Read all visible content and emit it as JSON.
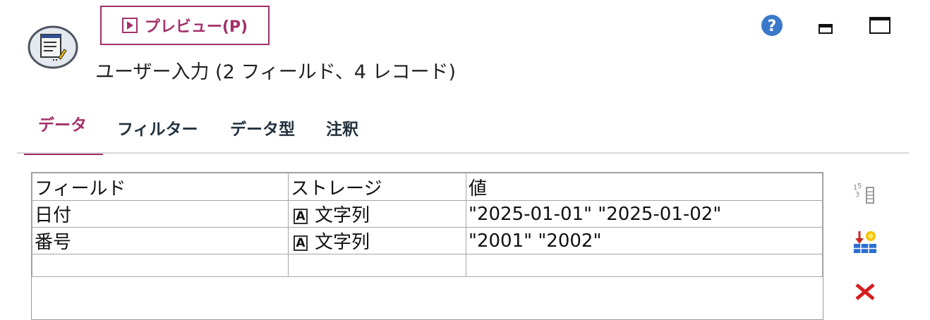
{
  "toolbar": {
    "preview_label": "プレビュー(P)"
  },
  "node": {
    "title": "ユーザー入力 (2 フィールド、4 レコード)"
  },
  "icons": {
    "node": "user-input-node-icon",
    "help": "help-icon",
    "minimize": "minimize-icon",
    "maximize": "maximize-icon",
    "side": [
      "numbered-list-icon",
      "generate-data-icon",
      "delete-icon"
    ]
  },
  "tabs": [
    {
      "label": "データ",
      "active": true
    },
    {
      "label": "フィルター",
      "active": false
    },
    {
      "label": "データ型",
      "active": false
    },
    {
      "label": "注釈",
      "active": false
    }
  ],
  "table": {
    "headers": [
      "フィールド",
      "ストレージ",
      "値"
    ],
    "rows": [
      {
        "field": "日付",
        "storage": "文字列",
        "value": "\"2025-01-01\" \"2025-01-02\""
      },
      {
        "field": "番号",
        "storage": "文字列",
        "value": "\"2001\" \"2002\""
      },
      {
        "field": "",
        "storage": "",
        "value": ""
      }
    ]
  },
  "colors": {
    "accent": "#a3306a",
    "tab_text": "#23323f",
    "help_blue": "#3a78c9"
  }
}
